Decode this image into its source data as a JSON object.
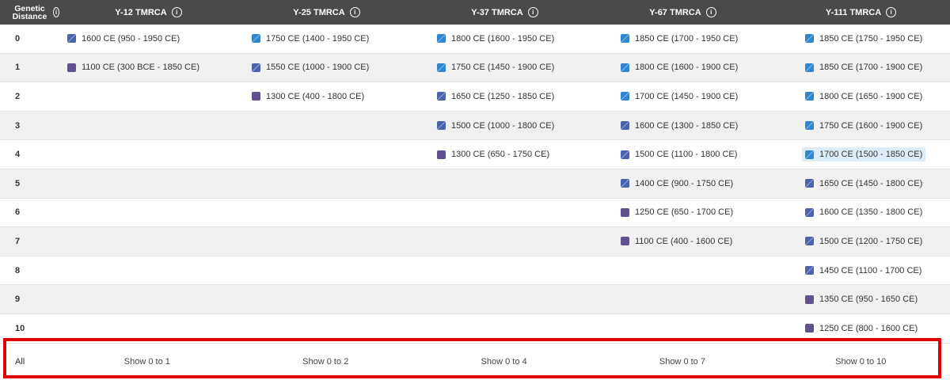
{
  "header": {
    "genetic_distance": "Genetic Distance",
    "columns": [
      "Y-12 TMRCA",
      "Y-25 TMRCA",
      "Y-37 TMRCA",
      "Y-67 TMRCA",
      "Y-111 TMRCA"
    ]
  },
  "colors": {
    "blue": "#2f86d1",
    "indigo": "#4b62ad",
    "purple": "#61518e",
    "highlight": "#dceefb",
    "outline": "#e00000"
  },
  "rows": [
    {
      "gd": "0",
      "cells": [
        {
          "text": "1600 CE (950 - 1950 CE)",
          "swatch": "indigo"
        },
        {
          "text": "1750 CE (1400 - 1950 CE)",
          "swatch": "blue"
        },
        {
          "text": "1800 CE (1600 - 1950 CE)",
          "swatch": "blue"
        },
        {
          "text": "1850 CE (1700 - 1950 CE)",
          "swatch": "blue"
        },
        {
          "text": "1850 CE (1750 - 1950 CE)",
          "swatch": "blue"
        }
      ]
    },
    {
      "gd": "1",
      "cells": [
        {
          "text": "1100 CE (300 BCE - 1850 CE)",
          "swatch": "purple"
        },
        {
          "text": "1550 CE (1000 - 1900 CE)",
          "swatch": "indigo"
        },
        {
          "text": "1750 CE (1450 - 1900 CE)",
          "swatch": "blue"
        },
        {
          "text": "1800 CE (1600 - 1900 CE)",
          "swatch": "blue"
        },
        {
          "text": "1850 CE (1700 - 1900 CE)",
          "swatch": "blue"
        }
      ]
    },
    {
      "gd": "2",
      "cells": [
        null,
        {
          "text": "1300 CE (400 - 1800 CE)",
          "swatch": "purple"
        },
        {
          "text": "1650 CE (1250 - 1850 CE)",
          "swatch": "indigo"
        },
        {
          "text": "1700 CE (1450 - 1900 CE)",
          "swatch": "blue"
        },
        {
          "text": "1800 CE (1650 - 1900 CE)",
          "swatch": "blue"
        }
      ]
    },
    {
      "gd": "3",
      "cells": [
        null,
        null,
        {
          "text": "1500 CE (1000 - 1800 CE)",
          "swatch": "indigo"
        },
        {
          "text": "1600 CE (1300 - 1850 CE)",
          "swatch": "indigo"
        },
        {
          "text": "1750 CE (1600 - 1900 CE)",
          "swatch": "blue"
        }
      ]
    },
    {
      "gd": "4",
      "cells": [
        null,
        null,
        {
          "text": "1300 CE (650 - 1750 CE)",
          "swatch": "purple"
        },
        {
          "text": "1500 CE (1100 - 1800 CE)",
          "swatch": "indigo"
        },
        {
          "text": "1700 CE (1500 - 1850 CE)",
          "swatch": "blue",
          "highlight": true
        }
      ]
    },
    {
      "gd": "5",
      "cells": [
        null,
        null,
        null,
        {
          "text": "1400 CE (900 - 1750 CE)",
          "swatch": "indigo"
        },
        {
          "text": "1650 CE (1450 - 1800 CE)",
          "swatch": "indigo"
        }
      ]
    },
    {
      "gd": "6",
      "cells": [
        null,
        null,
        null,
        {
          "text": "1250 CE (650 - 1700 CE)",
          "swatch": "purple"
        },
        {
          "text": "1600 CE (1350 - 1800 CE)",
          "swatch": "indigo"
        }
      ]
    },
    {
      "gd": "7",
      "cells": [
        null,
        null,
        null,
        {
          "text": "1100 CE (400 - 1600 CE)",
          "swatch": "purple"
        },
        {
          "text": "1500 CE (1200 - 1750 CE)",
          "swatch": "indigo"
        }
      ]
    },
    {
      "gd": "8",
      "cells": [
        null,
        null,
        null,
        null,
        {
          "text": "1450 CE (1100 - 1700 CE)",
          "swatch": "indigo"
        }
      ]
    },
    {
      "gd": "9",
      "cells": [
        null,
        null,
        null,
        null,
        {
          "text": "1350 CE (950 - 1650 CE)",
          "swatch": "purple"
        }
      ]
    },
    {
      "gd": "10",
      "cells": [
        null,
        null,
        null,
        null,
        {
          "text": "1250 CE (800 - 1600 CE)",
          "swatch": "purple"
        }
      ]
    }
  ],
  "footer": {
    "all": "All",
    "links": [
      "Show 0 to 1",
      "Show 0 to 2",
      "Show 0 to 4",
      "Show 0 to 7",
      "Show 0 to 10"
    ]
  }
}
